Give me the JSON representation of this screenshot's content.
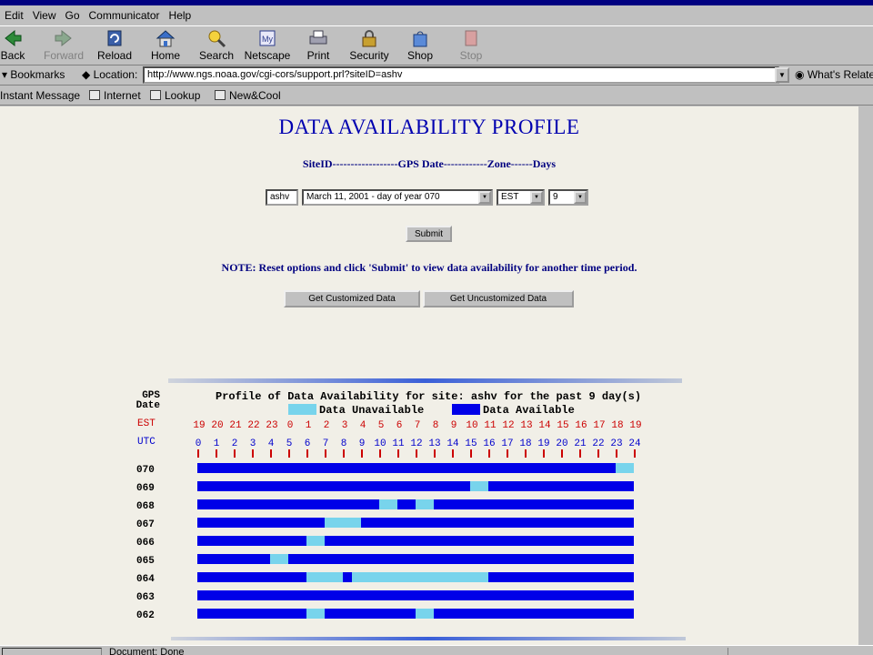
{
  "menu": [
    "Edit",
    "View",
    "Go",
    "Communicator",
    "Help"
  ],
  "toolbar": {
    "back": "Back",
    "forward": "Forward",
    "reload": "Reload",
    "home": "Home",
    "search": "Search",
    "netscape": "Netscape",
    "print": "Print",
    "security": "Security",
    "shop": "Shop",
    "stop": "Stop"
  },
  "location": {
    "bookmarks": "Bookmarks",
    "label": "Location:",
    "url": "http://www.ngs.noaa.gov/cgi-cors/support.prl?siteID=ashv",
    "related": "What's Related"
  },
  "personal": [
    "Instant Message",
    "Internet",
    "Lookup",
    "New&Cool"
  ],
  "page": {
    "title": "DATA AVAILABILITY PROFILE",
    "form_header": "SiteID------------------GPS Date------------Zone------Days",
    "site_id": "ashv",
    "gps_date": "March 11, 2001 - day of year 070",
    "zone": "EST",
    "days": "9",
    "submit": "Submit",
    "note": "NOTE: Reset options and click 'Submit' to view data availability for another time period.",
    "get_customized": "Get Customized Data",
    "get_uncustomized": "Get Uncustomized Data"
  },
  "status": {
    "text": "Document: Done"
  },
  "colors": {
    "available": "#0000e8",
    "unavailable": "#78d4ec",
    "tick": "#cc0000"
  },
  "chart_data": {
    "type": "table",
    "title": "Profile of Data Availability for site: ashv for the past 9 day(s)",
    "row_header": "GPS\nDate",
    "legend": {
      "unavailable": "Data Unavailable",
      "available": "Data Available"
    },
    "est_label": "EST",
    "utc_label": "UTC",
    "est_hours": [
      "19",
      "20",
      "21",
      "22",
      "23",
      "0",
      "1",
      "2",
      "3",
      "4",
      "5",
      "6",
      "7",
      "8",
      "9",
      "10",
      "11",
      "12",
      "13",
      "14",
      "15",
      "16",
      "17",
      "18",
      "19"
    ],
    "utc_hours": [
      "0",
      "1",
      "2",
      "3",
      "4",
      "5",
      "6",
      "7",
      "8",
      "9",
      "10",
      "11",
      "12",
      "13",
      "14",
      "15",
      "16",
      "17",
      "18",
      "19",
      "20",
      "21",
      "22",
      "23",
      "24"
    ],
    "days": [
      {
        "doy": "070",
        "unavailable_hours": [
          [
            23,
            24
          ]
        ]
      },
      {
        "doy": "069",
        "unavailable_hours": [
          [
            15,
            16
          ]
        ]
      },
      {
        "doy": "068",
        "unavailable_hours": [
          [
            10,
            11
          ],
          [
            12,
            13
          ]
        ]
      },
      {
        "doy": "067",
        "unavailable_hours": [
          [
            7,
            9
          ]
        ]
      },
      {
        "doy": "066",
        "unavailable_hours": [
          [
            6,
            7
          ]
        ]
      },
      {
        "doy": "065",
        "unavailable_hours": [
          [
            4,
            5
          ]
        ]
      },
      {
        "doy": "064",
        "unavailable_hours": [
          [
            6,
            8
          ],
          [
            8.5,
            16
          ]
        ]
      },
      {
        "doy": "063",
        "unavailable_hours": []
      },
      {
        "doy": "062",
        "unavailable_hours": [
          [
            6,
            7
          ],
          [
            12,
            13
          ]
        ]
      }
    ]
  }
}
